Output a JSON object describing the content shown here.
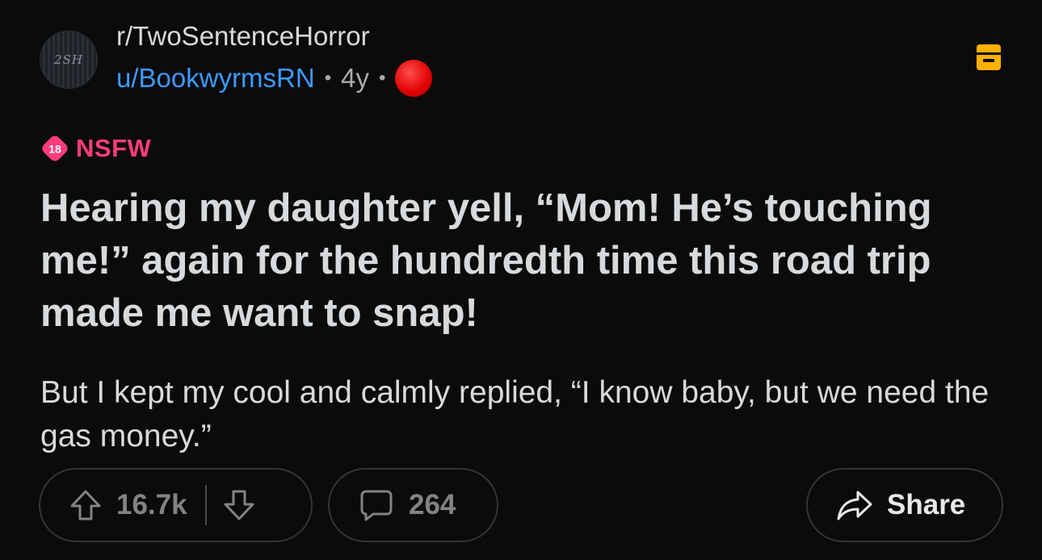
{
  "header": {
    "avatar_text": "2SH",
    "subreddit": "r/TwoSentenceHorror",
    "username": "u/BookwyrmsRN",
    "separator": "•",
    "age": "4y",
    "award_icon": "red-circle-award-icon",
    "archive_icon": "archive-icon",
    "archive_color": "#ffb000"
  },
  "post": {
    "nsfw_badge": "18",
    "nsfw_label": "NSFW",
    "nsfw_color": "#ff3c7f",
    "title": "Hearing my daughter yell, “Mom! He’s touching me!” again for the hundredth time this road trip made me want to snap!",
    "body": "But I kept my cool and calmly replied, “I know baby, but we need the gas money.”"
  },
  "actions": {
    "upvote_icon": "upvote-arrow-icon",
    "score": "16.7k",
    "downvote_icon": "downvote-arrow-icon",
    "comment_icon": "comment-bubble-icon",
    "comment_count": "264",
    "share_icon": "share-arrow-icon",
    "share_label": "Share"
  }
}
